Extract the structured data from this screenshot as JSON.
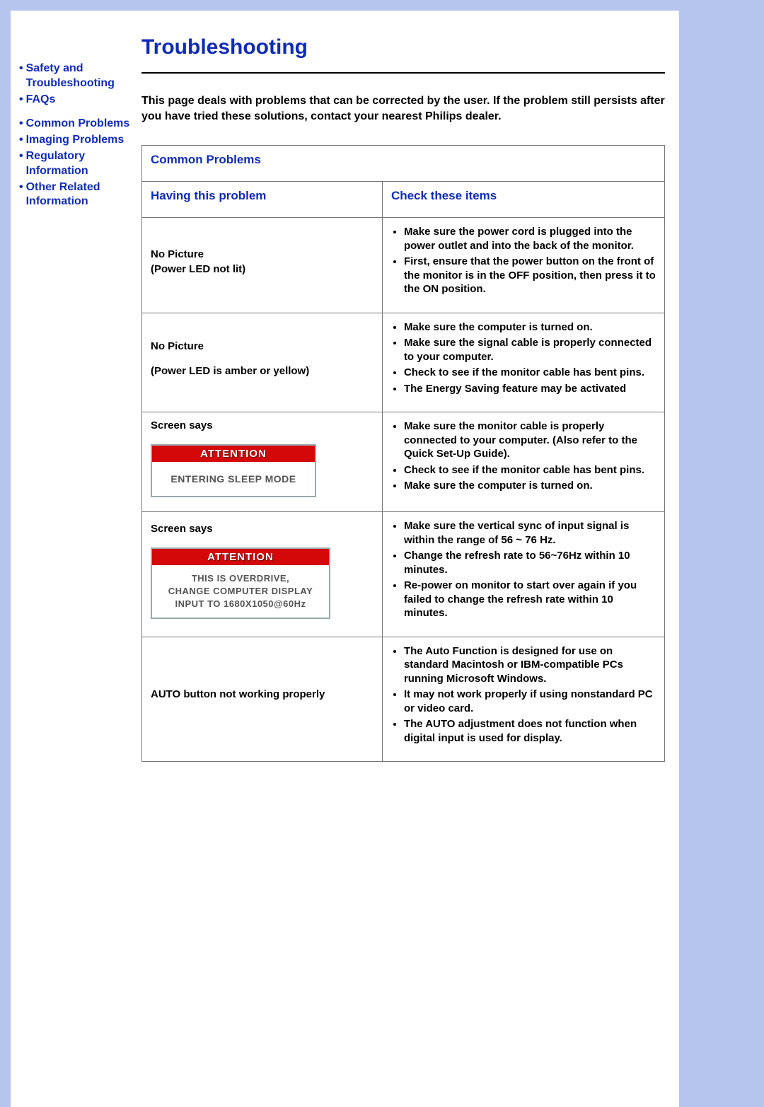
{
  "sidebar": {
    "items": [
      {
        "label": "Safety and Troubleshooting"
      },
      {
        "label": "FAQs"
      },
      {
        "label": "Common Problems"
      },
      {
        "label": "Imaging Problems"
      },
      {
        "label": "Regulatory Information"
      },
      {
        "label": "Other Related Information"
      }
    ]
  },
  "title": "Troubleshooting",
  "intro": "This page deals with problems that can be corrected by the user. If the problem still persists after you have tried these solutions, contact your nearest Philips dealer.",
  "table": {
    "section_header": "Common Problems",
    "col1": "Having this problem",
    "col2": "Check these items",
    "rows": [
      {
        "problem_title": "No Picture",
        "problem_sub": "(Power LED not lit)",
        "checks": [
          "Make sure the power cord is plugged into the power outlet and into the back of the monitor.",
          "First, ensure that the power button on the front of the monitor is in the OFF position, then press it to the ON position."
        ]
      },
      {
        "problem_title": "No Picture",
        "problem_sub": "(Power LED is amber or yellow)",
        "checks": [
          "Make sure the computer is turned on.",
          "Make sure the signal cable is properly connected to your computer.",
          "Check to see if the monitor cable has bent pins.",
          "The Energy Saving feature may be activated"
        ]
      },
      {
        "problem_title": "Screen says",
        "attention": {
          "header": "ATTENTION",
          "body": "ENTERING SLEEP MODE"
        },
        "checks": [
          "Make sure the monitor cable is properly connected to your computer. (Also refer to the Quick Set-Up Guide).",
          "Check to see if the monitor cable has bent pins.",
          "Make sure the computer is turned on."
        ]
      },
      {
        "problem_title": "Screen says",
        "attention": {
          "header": "ATTENTION",
          "body_lines": [
            "THIS IS OVERDRIVE,",
            "CHANGE COMPUTER DISPLAY",
            "INPUT TO 1680X1050@60Hz"
          ]
        },
        "checks": [
          "Make sure the vertical sync of input signal is within the range of 56 ~ 76 Hz.",
          "Change the refresh rate to 56~76Hz within 10 minutes.",
          "Re-power on monitor to start over again if you failed to change the refresh rate within 10 minutes."
        ]
      },
      {
        "problem_title": "AUTO button not working properly",
        "checks": [
          "The Auto Function is designed for use on standard Macintosh or IBM-compatible PCs running Microsoft Windows.",
          "It may not work properly if using nonstandard PC or video card.",
          "The AUTO adjustment does not function when digital input is used for display."
        ]
      }
    ]
  }
}
